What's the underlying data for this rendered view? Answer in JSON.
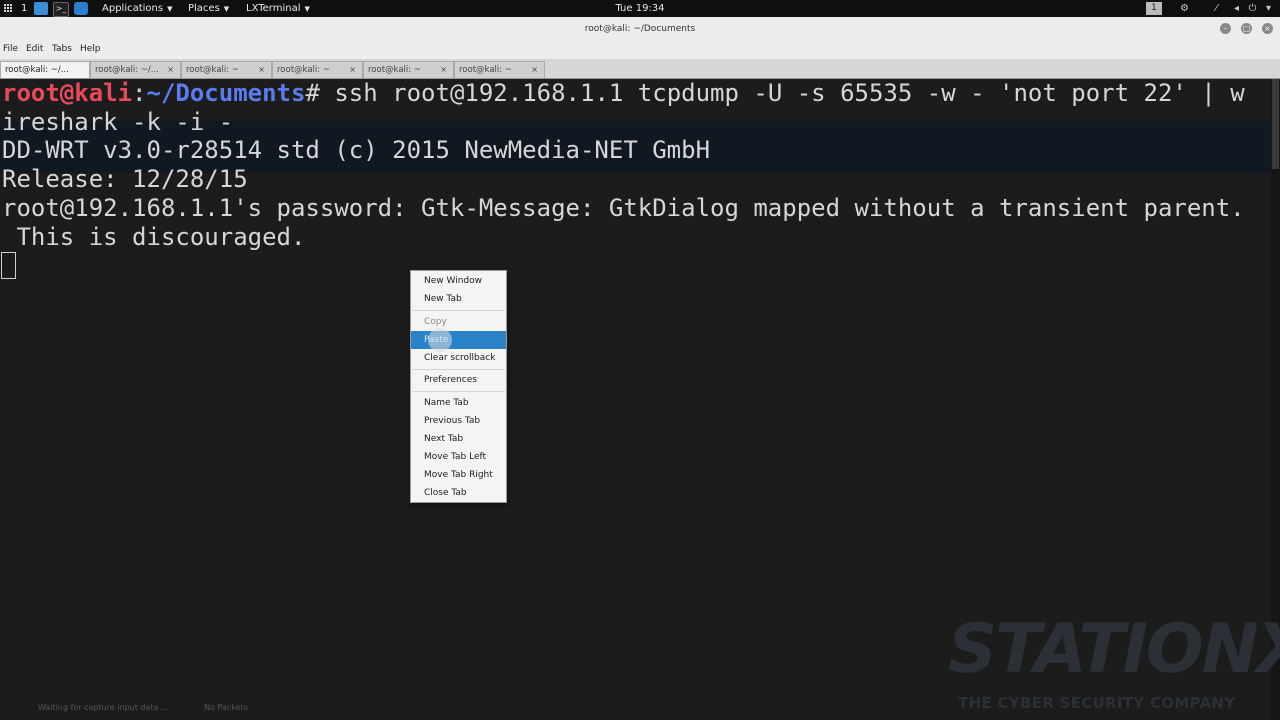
{
  "topbar": {
    "workspace_number": "1",
    "applications_label": "Applications",
    "places_label": "Places",
    "terminal_task_label": "LXTerminal",
    "clock": "Tue 19:34",
    "workspace_badge": "1",
    "icons": [
      "apps-grid-icon",
      "desktop-icon",
      "terminal-icon",
      "kali-icon",
      "network-icon",
      "wifi-icon",
      "volume-icon",
      "power-icon"
    ]
  },
  "window": {
    "title": "root@kali: ~/Documents",
    "menu": [
      "File",
      "Edit",
      "Tabs",
      "Help"
    ],
    "tabs": [
      {
        "label": "root@kali: ~/..."
      },
      {
        "label": "root@kali: ~/..."
      },
      {
        "label": "root@kali: ~"
      },
      {
        "label": "root@kali: ~"
      },
      {
        "label": "root@kali: ~"
      },
      {
        "label": "root@kali: ~"
      }
    ],
    "tab_close": "×"
  },
  "terminal": {
    "prompt_user": "root@kali",
    "prompt_sep": ":",
    "prompt_path": "~/Documents",
    "prompt_hash": "#",
    "command_part1": " ssh root@192.168.1.1 tcpdump -U -s 65535 -w - 'not port 22' | w",
    "command_part2": "ireshark -k -i -",
    "line3": "DD-WRT v3.0-r28514 std (c) 2015 NewMedia-NET GmbH",
    "line4": "Release: 12/28/15",
    "line5": "root@192.168.1.1's password: Gtk-Message: GtkDialog mapped without a transient parent.",
    "line6": " This is discouraged."
  },
  "context_menu": {
    "new_window": "New Window",
    "new_tab": "New Tab",
    "copy": "Copy",
    "paste": "Paste",
    "clear_scrollback": "Clear scrollback",
    "preferences": "Preferences",
    "name_tab": "Name Tab",
    "previous_tab": "Previous Tab",
    "next_tab": "Next Tab",
    "move_tab_left": "Move Tab Left",
    "move_tab_right": "Move Tab Right",
    "close_tab": "Close Tab"
  },
  "background_status": {
    "left": "Waiting for capture input data ...",
    "right": "No Packets"
  },
  "watermark": {
    "brand": "STATIONX",
    "tagline": "THE CYBER SECURITY COMPANY"
  },
  "colors": {
    "prompt_user": "#e8495b",
    "prompt_path": "#5b7cf0",
    "menu_highlight": "#2a82c8",
    "terminal_bg": "#1c1c1c"
  }
}
